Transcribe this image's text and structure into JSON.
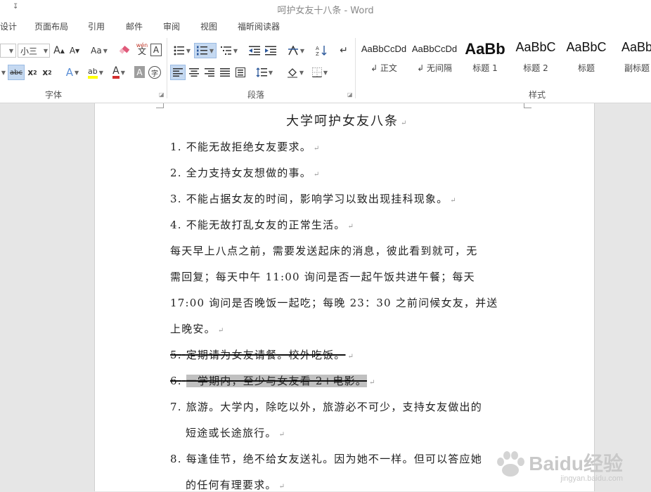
{
  "titlebar": {
    "qat_glyph": "↧",
    "title": "呵护女友十八条 - Word"
  },
  "tabs": [
    "设计",
    "页面布局",
    "引用",
    "邮件",
    "审阅",
    "视图",
    "福昕阅读器"
  ],
  "ribbon": {
    "font_group": {
      "label": "字体",
      "font_size": "小三",
      "grow_font": "A",
      "shrink_font": "A",
      "change_case": "Aa",
      "phonetic_top": "wén",
      "phonetic_bottom": "文",
      "char_border": "A",
      "strikethrough": "abc",
      "subscript": "x",
      "subscript_mark": "2",
      "superscript": "x",
      "superscript_mark": "2",
      "text_effect": "A",
      "highlight": "ab",
      "font_color": "A",
      "char_shading": "A",
      "enclose": "字"
    },
    "paragraph_group": {
      "label": "段落"
    },
    "styles_group": {
      "label": "样式",
      "items": [
        {
          "sample": "AaBbCcDd",
          "name": "↲ 正文"
        },
        {
          "sample": "AaBbCcDd",
          "name": "↲ 无间隔"
        },
        {
          "sample": "AaBb",
          "name": "标题 1"
        },
        {
          "sample": "AaBbC",
          "name": "标题 2"
        },
        {
          "sample": "AaBbC",
          "name": "标题"
        },
        {
          "sample": "AaBb",
          "name": "副标题"
        }
      ]
    }
  },
  "document": {
    "title": "大学呵护女友八条",
    "pilcrow": "↵",
    "items": [
      {
        "num": "1.",
        "text": "不能无故拒绝女友要求。"
      },
      {
        "num": "2.",
        "text": "全力支持女友想做的事。"
      },
      {
        "num": "3.",
        "text": "不能占据女友的时间，影响学习以致出现挂科现象。"
      },
      {
        "num": "4.",
        "text": "不能无故打乱女友的正常生活。"
      }
    ],
    "paragraph_lines": [
      "每天早上八点之前，需要发送起床的消息，彼此看到就可，无",
      "需回复；每天中午 11:00 询问是否一起午饭共进午餐；每天",
      "17:00 询问是否晚饭一起吃；每晚 23：30 之前问候女友，并送",
      "上晚安。"
    ],
    "struck_items": [
      {
        "num": "5.",
        "text": "定期请为女友请餐。校外吃饭。"
      },
      {
        "num": "6.",
        "text": "一学期内，至少与女友看 2+电影。"
      }
    ],
    "item7": {
      "num": "7.",
      "line1": "旅游。大学内，除吃以外，旅游必不可少，支持女友做出的",
      "line2": "短途或长途旅行。"
    },
    "item8": {
      "num": "8.",
      "line1": "每逢佳节，绝不给女友送礼。因为她不一样。但可以答应她",
      "line2": "的任何有理要求。"
    }
  },
  "watermark": {
    "brand": "Baidu经验",
    "url": "jingyan.baidu.com"
  }
}
